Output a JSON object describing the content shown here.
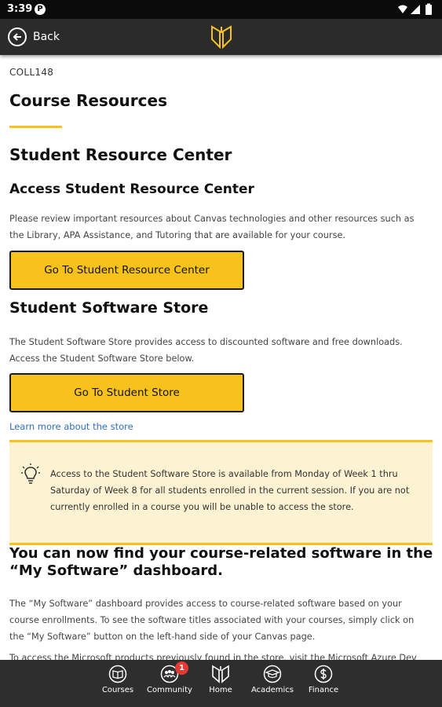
{
  "status_bar": {
    "time": "3:39",
    "notification_letter": "P"
  },
  "app_bar": {
    "back_label": "Back"
  },
  "page": {
    "course_code": "COLL148",
    "title": "Course Resources",
    "src_heading": "Student Resource Center",
    "access_heading": "Access Student Resource Center",
    "src_paragraph": "Please review important resources about Canvas technologies and other resources such as the Library, APA Assistance, and Tutoring that are available for your course.",
    "src_button": "Go To Student Resource Center",
    "store_heading": "Student Software Store",
    "store_paragraph": "The Student Software Store provides access to discounted software and free downloads. Access the Student Software Store below.",
    "store_button": "Go To Student Store",
    "learn_more_link": "Learn more about the store",
    "callout_text": "Access to the Student Software Store is available from Monday of Week 1 thru Saturday of Week 8 for all students enrolled in the current session. If you are not currently enrolled in a course you will be unable to access the store.",
    "software_heading": "You can now find your course-related software in the “My Software” dashboard.",
    "software_paragraph": "The “My Software” dashboard provides access to course-related software based on your course enrollments. To see the software titles associated with your courses, simply click on the “My Software” button on the left-hand side of your Canvas page.",
    "microsoft_paragraph": "To access the Microsoft products previously found in the store, visit the Microsoft Azure Dev"
  },
  "bottom_nav": {
    "items": [
      {
        "label": "Courses",
        "icon": "book-icon"
      },
      {
        "label": "Community",
        "icon": "people-icon",
        "badge": "1"
      },
      {
        "label": "Home",
        "icon": "home-logo-icon"
      },
      {
        "label": "Academics",
        "icon": "graduation-cap-icon"
      },
      {
        "label": "Finance",
        "icon": "dollar-icon"
      }
    ]
  },
  "colors": {
    "accent": "#f7c21b",
    "app_bar": "#2b2b2b",
    "callout_bg": "#fdf2d2",
    "link": "#2d6fc8",
    "badge": "#e53935"
  }
}
